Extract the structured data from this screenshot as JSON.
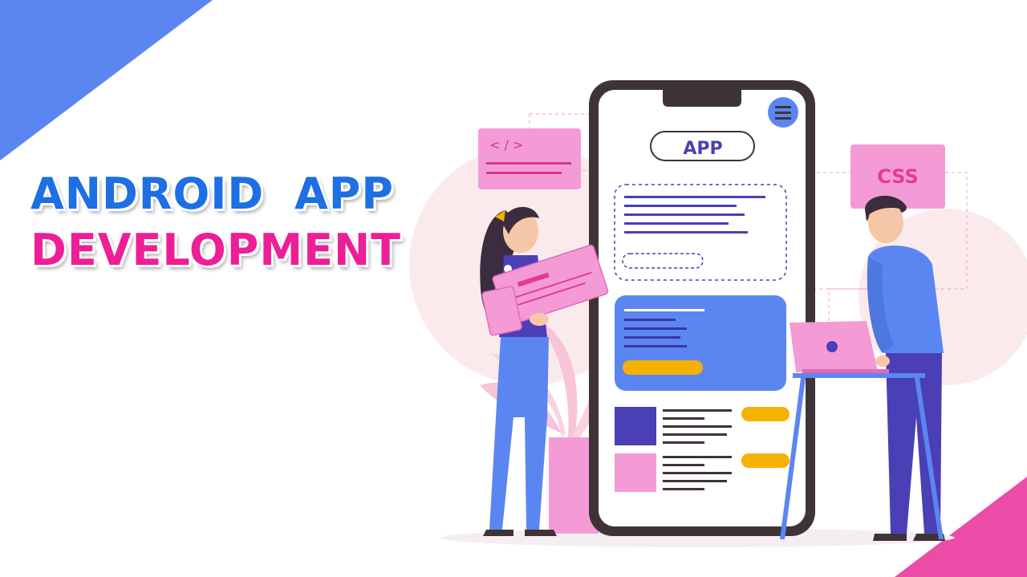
{
  "hero": {
    "title_line1": "ANDROID APP",
    "title_line2": "DEVELOPMENT"
  },
  "illustration": {
    "phone_header_label": "APP",
    "code_card_label": "< / >",
    "css_card_label": "CSS"
  },
  "colors": {
    "blue_corner": "#5b86f2",
    "pink_corner": "#ea4ca8",
    "title_blue": "#1d6fe3",
    "title_pink": "#ec1f97",
    "phone_frame": "#3e3438",
    "indigo": "#4a3fb5",
    "card_blue": "#5b86f2",
    "accent_yellow": "#f5b100",
    "card_pink": "#f49bd6"
  }
}
